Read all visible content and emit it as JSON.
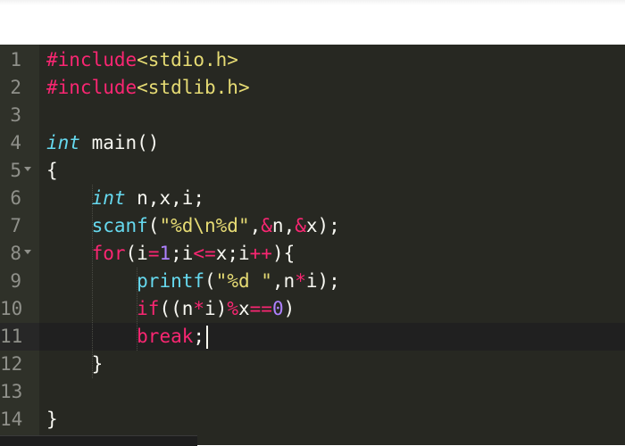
{
  "theme": {
    "background": "#272822",
    "gutter": "#2f3129",
    "keyword": "#f92672",
    "type": "#66d9ef",
    "string": "#e6db74",
    "number": "#ae81ff",
    "text": "#f8f8f2"
  },
  "editor": {
    "lines": [
      {
        "number": "1",
        "foldable": false,
        "tokens": [
          {
            "t": "kw",
            "v": "#include"
          },
          {
            "t": "st",
            "v": "<stdio.h>"
          }
        ]
      },
      {
        "number": "2",
        "foldable": false,
        "tokens": [
          {
            "t": "kw",
            "v": "#include"
          },
          {
            "t": "st",
            "v": "<stdlib.h>"
          }
        ]
      },
      {
        "number": "3",
        "foldable": false,
        "tokens": []
      },
      {
        "number": "4",
        "foldable": false,
        "tokens": [
          {
            "t": "ty",
            "v": "int"
          },
          {
            "t": "pl",
            "v": " main()"
          }
        ]
      },
      {
        "number": "5",
        "foldable": true,
        "tokens": [
          {
            "t": "pl",
            "v": "{"
          }
        ]
      },
      {
        "number": "6",
        "foldable": false,
        "tokens": [
          {
            "t": "pl",
            "v": "    "
          },
          {
            "t": "ty",
            "v": "int"
          },
          {
            "t": "pl",
            "v": " n,x,i;"
          }
        ]
      },
      {
        "number": "7",
        "foldable": false,
        "tokens": [
          {
            "t": "pl",
            "v": "    "
          },
          {
            "t": "fn",
            "v": "scanf"
          },
          {
            "t": "pl",
            "v": "("
          },
          {
            "t": "st",
            "v": "\"%d\\n%d\""
          },
          {
            "t": "pl",
            "v": ","
          },
          {
            "t": "op",
            "v": "&"
          },
          {
            "t": "pl",
            "v": "n,"
          },
          {
            "t": "op",
            "v": "&"
          },
          {
            "t": "pl",
            "v": "x);"
          }
        ]
      },
      {
        "number": "8",
        "foldable": true,
        "tokens": [
          {
            "t": "pl",
            "v": "    "
          },
          {
            "t": "kw",
            "v": "for"
          },
          {
            "t": "pl",
            "v": "(i"
          },
          {
            "t": "op",
            "v": "="
          },
          {
            "t": "nm",
            "v": "1"
          },
          {
            "t": "pl",
            "v": ";i"
          },
          {
            "t": "op",
            "v": "<="
          },
          {
            "t": "pl",
            "v": "x;i"
          },
          {
            "t": "op",
            "v": "++"
          },
          {
            "t": "pl",
            "v": "){"
          }
        ]
      },
      {
        "number": "9",
        "foldable": false,
        "tokens": [
          {
            "t": "pl",
            "v": "        "
          },
          {
            "t": "fn",
            "v": "printf"
          },
          {
            "t": "pl",
            "v": "("
          },
          {
            "t": "st",
            "v": "\"%d \""
          },
          {
            "t": "pl",
            "v": ",n"
          },
          {
            "t": "op",
            "v": "*"
          },
          {
            "t": "pl",
            "v": "i);"
          }
        ]
      },
      {
        "number": "10",
        "foldable": false,
        "tokens": [
          {
            "t": "pl",
            "v": "        "
          },
          {
            "t": "kw",
            "v": "if"
          },
          {
            "t": "pl",
            "v": "((n"
          },
          {
            "t": "op",
            "v": "*"
          },
          {
            "t": "pl",
            "v": "i)"
          },
          {
            "t": "op",
            "v": "%"
          },
          {
            "t": "pl",
            "v": "x"
          },
          {
            "t": "op",
            "v": "=="
          },
          {
            "t": "nm",
            "v": "0"
          },
          {
            "t": "pl",
            "v": ")"
          }
        ]
      },
      {
        "number": "11",
        "foldable": false,
        "active": true,
        "tokens": [
          {
            "t": "pl",
            "v": "        "
          },
          {
            "t": "kw",
            "v": "break"
          },
          {
            "t": "pl",
            "v": ";"
          }
        ]
      },
      {
        "number": "12",
        "foldable": false,
        "tokens": [
          {
            "t": "pl",
            "v": "    }"
          }
        ]
      },
      {
        "number": "13",
        "foldable": false,
        "tokens": []
      },
      {
        "number": "14",
        "foldable": false,
        "tokens": [
          {
            "t": "pl",
            "v": "}"
          }
        ]
      }
    ]
  }
}
